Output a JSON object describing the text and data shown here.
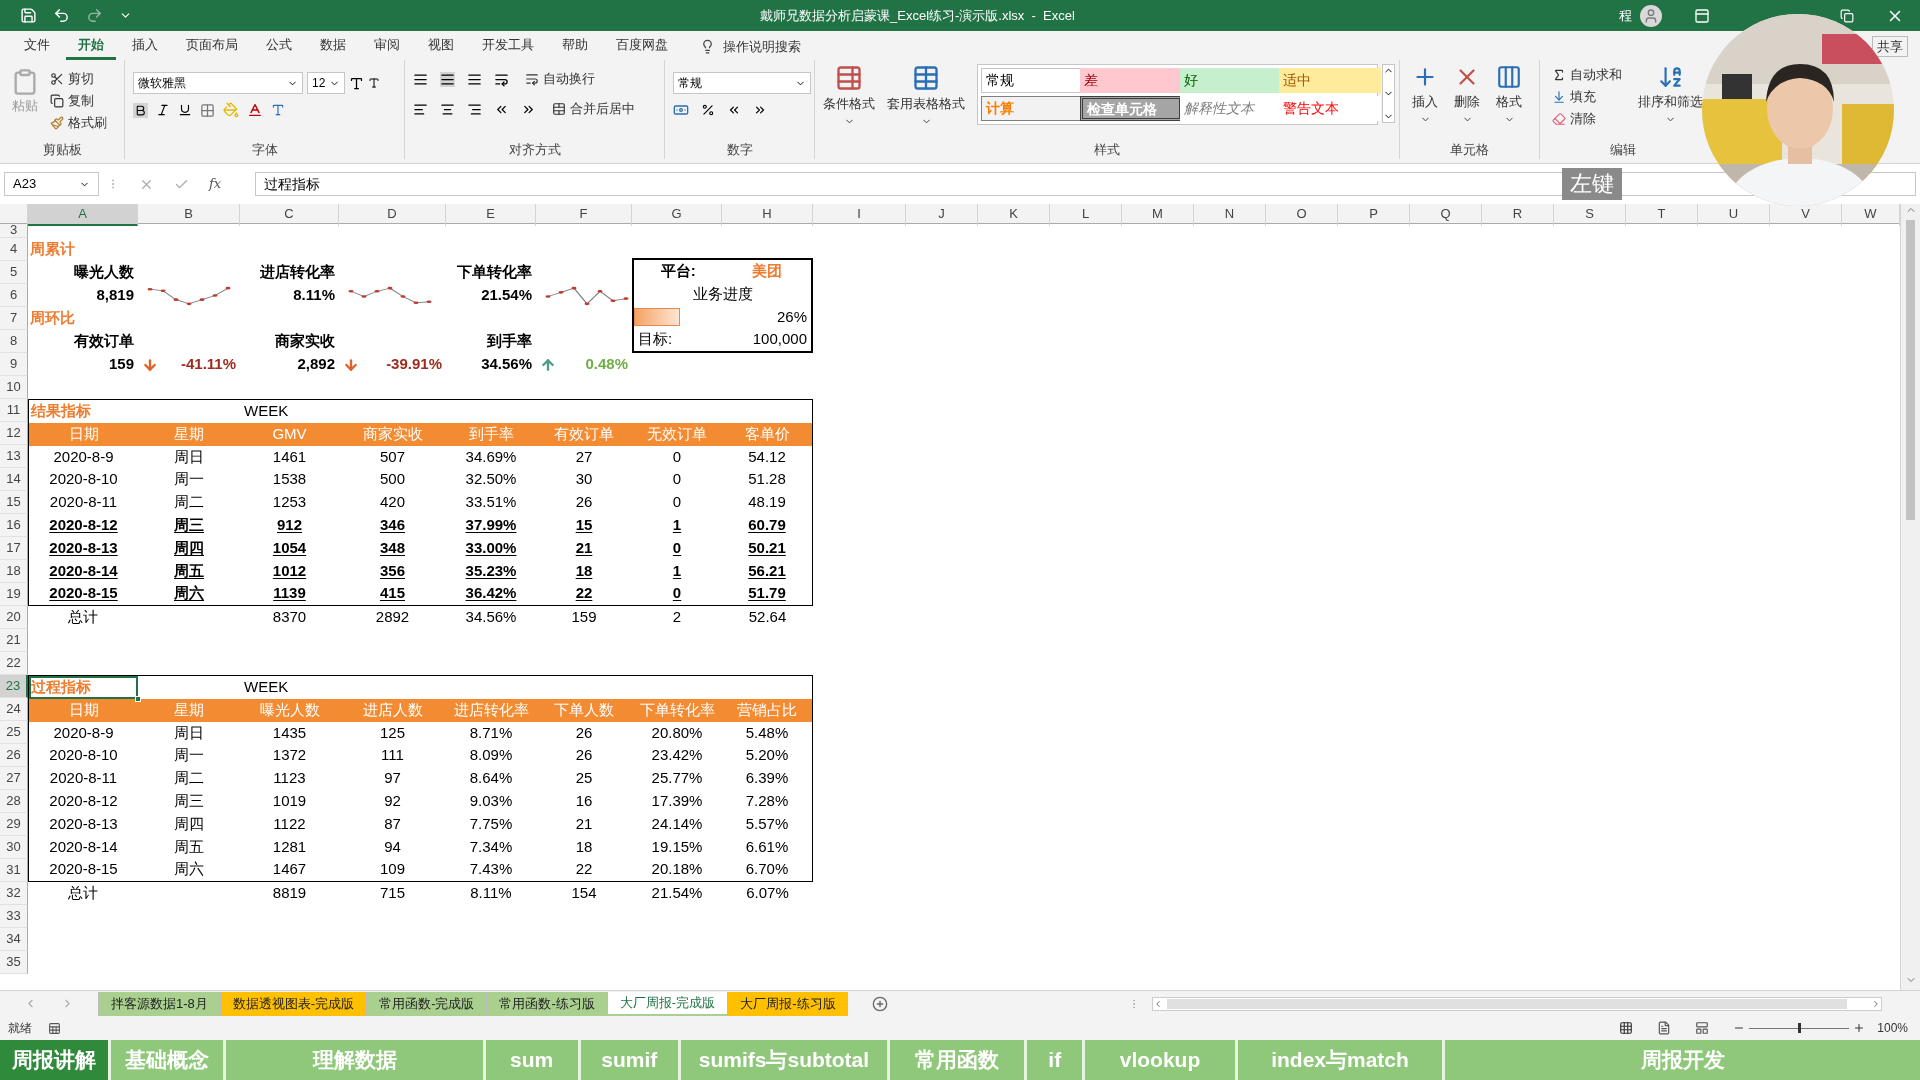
{
  "title_bar": {
    "title": "戴师兄数据分析启蒙课_Excel练习-演示版.xlsx  -  Excel",
    "user_initial": "程"
  },
  "menu_tabs": [
    {
      "label": "文件",
      "selected": false
    },
    {
      "label": "开始",
      "selected": true
    },
    {
      "label": "插入",
      "selected": false
    },
    {
      "label": "页面布局",
      "selected": false
    },
    {
      "label": "公式",
      "selected": false
    },
    {
      "label": "数据",
      "selected": false
    },
    {
      "label": "审阅",
      "selected": false
    },
    {
      "label": "视图",
      "selected": false
    },
    {
      "label": "开发工具",
      "selected": false
    },
    {
      "label": "帮助",
      "selected": false
    },
    {
      "label": "百度网盘",
      "selected": false
    }
  ],
  "tell_me": "操作说明搜索",
  "share": "共享",
  "ribbon": {
    "clipboard": {
      "paste": "粘贴",
      "cut": "剪切",
      "copy": "复制",
      "format_painter": "格式刷",
      "label": "剪贴板"
    },
    "font": {
      "name": "微软雅黑",
      "size": "12",
      "label": "字体"
    },
    "alignment": {
      "wrap": "自动换行",
      "merge": "合并后居中",
      "label": "对齐方式"
    },
    "number": {
      "format": "常规",
      "label": "数字"
    },
    "styles": {
      "conditional": "条件格式",
      "table_format": "套用表格格式",
      "label": "样式",
      "gallery": [
        {
          "label": "常规",
          "kind": "normal"
        },
        {
          "label": "差",
          "kind": "bad"
        },
        {
          "label": "好",
          "kind": "good"
        },
        {
          "label": "适中",
          "kind": "neutral"
        },
        {
          "label": "计算",
          "kind": "calculation"
        },
        {
          "label": "检查单元格",
          "kind": "check"
        },
        {
          "label": "解释性文本",
          "kind": "explanatory"
        },
        {
          "label": "警告文本",
          "kind": "warning"
        }
      ]
    },
    "cells": {
      "buttons": [
        "插入",
        "删除",
        "格式"
      ],
      "label": "单元格"
    },
    "editing": {
      "autosum": "自动求和",
      "fill": "填充",
      "clear": "清除",
      "sort": "排序和筛选",
      "label": "编辑"
    }
  },
  "formula_bar": {
    "name_box": "A23",
    "function_label": "fx",
    "content": "过程指标"
  },
  "key_hint": "左键",
  "columns": [
    {
      "label": "A",
      "selected": true
    },
    {
      "label": "B",
      "selected": false
    },
    {
      "label": "C",
      "selected": false
    },
    {
      "label": "D",
      "selected": false
    },
    {
      "label": "E",
      "selected": false
    },
    {
      "label": "F",
      "selected": false
    },
    {
      "label": "G",
      "selected": false
    },
    {
      "label": "H",
      "selected": false
    },
    {
      "label": "I",
      "selected": false
    },
    {
      "label": "J",
      "selected": false
    },
    {
      "label": "K",
      "selected": false
    },
    {
      "label": "L",
      "selected": false
    },
    {
      "label": "M",
      "selected": false
    },
    {
      "label": "N",
      "selected": false
    },
    {
      "label": "O",
      "selected": false
    },
    {
      "label": "P",
      "selected": false
    },
    {
      "label": "Q",
      "selected": false
    },
    {
      "label": "R",
      "selected": false
    },
    {
      "label": "S",
      "selected": false
    },
    {
      "label": "T",
      "selected": false
    },
    {
      "label": "U",
      "selected": false
    },
    {
      "label": "V",
      "selected": false
    },
    {
      "label": "W",
      "selected": false
    }
  ],
  "rows": [
    {
      "label": "3",
      "selected": false
    },
    {
      "label": "4",
      "selected": false
    },
    {
      "label": "5",
      "selected": false
    },
    {
      "label": "6",
      "selected": false
    },
    {
      "label": "7",
      "selected": false
    },
    {
      "label": "8",
      "selected": false
    },
    {
      "label": "9",
      "selected": false
    },
    {
      "label": "10",
      "selected": false
    },
    {
      "label": "11",
      "selected": false
    },
    {
      "label": "12",
      "selected": false
    },
    {
      "label": "13",
      "selected": false
    },
    {
      "label": "14",
      "selected": false
    },
    {
      "label": "15",
      "selected": false
    },
    {
      "label": "16",
      "selected": false
    },
    {
      "label": "17",
      "selected": false
    },
    {
      "label": "18",
      "selected": false
    },
    {
      "label": "19",
      "selected": false
    },
    {
      "label": "20",
      "selected": false
    },
    {
      "label": "21",
      "selected": false
    },
    {
      "label": "22",
      "selected": false
    },
    {
      "label": "23",
      "selected": true
    },
    {
      "label": "24",
      "selected": false
    },
    {
      "label": "25",
      "selected": false
    },
    {
      "label": "26",
      "selected": false
    },
    {
      "label": "27",
      "selected": false
    },
    {
      "label": "28",
      "selected": false
    },
    {
      "label": "29",
      "selected": false
    },
    {
      "label": "30",
      "selected": false
    },
    {
      "label": "31",
      "selected": false
    },
    {
      "label": "32",
      "selected": false
    },
    {
      "label": "33",
      "selected": false
    },
    {
      "label": "34",
      "selected": false
    },
    {
      "label": "35",
      "selected": false
    }
  ],
  "summary": {
    "cumulative_label": "周累计",
    "metrics": [
      {
        "label": "曝光人数",
        "value": "8,819"
      },
      {
        "label": "进店转化率",
        "value": "8.11%"
      },
      {
        "label": "下单转化率",
        "value": "21.54%"
      }
    ],
    "wow_label": "周环比",
    "wow": [
      {
        "label": "有效订单",
        "value": "159",
        "rising": false,
        "change": "-41.11%"
      },
      {
        "label": "商家实收",
        "value": "2,892",
        "rising": false,
        "change": "-39.91%"
      },
      {
        "label": "到手率",
        "value": "34.56%",
        "rising": true,
        "change": "0.48%"
      }
    ]
  },
  "platform_box": {
    "platform_label": "平台:",
    "platform": "美团",
    "progress_label": "业务进度",
    "level": 0.26,
    "percent": "26%",
    "target_label": "目标:",
    "target": "100,000"
  },
  "tables": [
    {
      "title": "结果指标",
      "selected": false,
      "week": "WEEK",
      "headers": [
        "日期",
        "星期",
        "GMV",
        "商家实收",
        "到手率",
        "有效订单",
        "无效订单",
        "客单价"
      ],
      "rows": [
        {
          "emphasized": false,
          "cells": [
            "2020-8-9",
            "周日",
            "1461",
            "507",
            "34.69%",
            "27",
            "0",
            "54.12"
          ]
        },
        {
          "emphasized": false,
          "cells": [
            "2020-8-10",
            "周一",
            "1538",
            "500",
            "32.50%",
            "30",
            "0",
            "51.28"
          ]
        },
        {
          "emphasized": false,
          "cells": [
            "2020-8-11",
            "周二",
            "1253",
            "420",
            "33.51%",
            "26",
            "0",
            "48.19"
          ]
        },
        {
          "emphasized": true,
          "cells": [
            "2020-8-12",
            "周三",
            "912",
            "346",
            "37.99%",
            "15",
            "1",
            "60.79"
          ]
        },
        {
          "emphasized": true,
          "cells": [
            "2020-8-13",
            "周四",
            "1054",
            "348",
            "33.00%",
            "21",
            "0",
            "50.21"
          ]
        },
        {
          "emphasized": true,
          "cells": [
            "2020-8-14",
            "周五",
            "1012",
            "356",
            "35.23%",
            "18",
            "1",
            "56.21"
          ]
        },
        {
          "emphasized": true,
          "cells": [
            "2020-8-15",
            "周六",
            "1139",
            "415",
            "36.42%",
            "22",
            "0",
            "51.79"
          ]
        }
      ],
      "total_label": "总计",
      "totals": [
        "8370",
        "2892",
        "34.56%",
        "159",
        "2",
        "52.64"
      ]
    },
    {
      "title": "过程指标",
      "selected": true,
      "week": "WEEK",
      "headers": [
        "日期",
        "星期",
        "曝光人数",
        "进店人数",
        "进店转化率",
        "下单人数",
        "下单转化率",
        "营销占比"
      ],
      "rows": [
        {
          "emphasized": false,
          "cells": [
            "2020-8-9",
            "周日",
            "1435",
            "125",
            "8.71%",
            "26",
            "20.80%",
            "5.48%"
          ]
        },
        {
          "emphasized": false,
          "cells": [
            "2020-8-10",
            "周一",
            "1372",
            "111",
            "8.09%",
            "26",
            "23.42%",
            "5.20%"
          ]
        },
        {
          "emphasized": false,
          "cells": [
            "2020-8-11",
            "周二",
            "1123",
            "97",
            "8.64%",
            "25",
            "25.77%",
            "6.39%"
          ]
        },
        {
          "emphasized": false,
          "cells": [
            "2020-8-12",
            "周三",
            "1019",
            "92",
            "9.03%",
            "16",
            "17.39%",
            "7.28%"
          ]
        },
        {
          "emphasized": false,
          "cells": [
            "2020-8-13",
            "周四",
            "1122",
            "87",
            "7.75%",
            "21",
            "24.14%",
            "5.57%"
          ]
        },
        {
          "emphasized": false,
          "cells": [
            "2020-8-14",
            "周五",
            "1281",
            "94",
            "7.34%",
            "18",
            "19.15%",
            "6.61%"
          ]
        },
        {
          "emphasized": false,
          "cells": [
            "2020-8-15",
            "周六",
            "1467",
            "109",
            "7.43%",
            "22",
            "20.18%",
            "6.70%"
          ]
        }
      ],
      "total_label": "总计",
      "totals": [
        "8819",
        "715",
        "8.11%",
        "154",
        "21.54%",
        "6.07%"
      ]
    }
  ],
  "sheet_tabs": [
    {
      "label": "拌客源数据1-8月",
      "selected": false,
      "color": "#a9d08e"
    },
    {
      "label": "数据透视图表-完成版",
      "selected": false,
      "color": "#ffc000"
    },
    {
      "label": "常用函数-完成版",
      "selected": false,
      "color": "#a9d08e"
    },
    {
      "label": "常用函数-练习版",
      "selected": false,
      "color": "#a9d08e"
    },
    {
      "label": "大厂周报-完成版",
      "selected": true,
      "color": "#a9d08e"
    },
    {
      "label": "大厂周报-练习版",
      "selected": false,
      "color": "#ffc000"
    }
  ],
  "status": {
    "text": "就绪",
    "zoom_slider": {
      "level": 0.5
    },
    "zoom": "100%"
  },
  "chapters": [
    {
      "label": "周报讲解",
      "selected": true
    },
    {
      "label": "基础概念",
      "selected": false
    },
    {
      "label": "理解数据",
      "selected": false
    },
    {
      "label": "sum",
      "selected": false
    },
    {
      "label": "sumif",
      "selected": false
    },
    {
      "label": "sumifs与subtotal",
      "selected": false
    },
    {
      "label": "常用函数",
      "selected": false
    },
    {
      "label": "if",
      "selected": false
    },
    {
      "label": "vlookup",
      "selected": false
    },
    {
      "label": "index与match",
      "selected": false
    },
    {
      "label": "周报开发",
      "selected": false
    }
  ]
}
